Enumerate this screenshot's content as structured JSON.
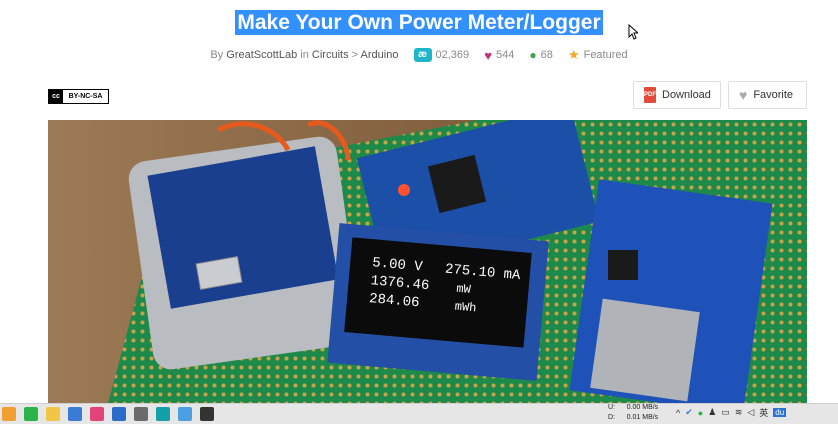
{
  "title": "Make Your Own Power Meter/Logger",
  "meta": {
    "by": "By",
    "author": "GreatScottLab",
    "in": "in",
    "category": "Circuits",
    "sep": ">",
    "subcategory": "Arduino",
    "views": "02,369",
    "favorites": "544",
    "comments": "68",
    "featured": "Featured"
  },
  "license": {
    "icon": "cc",
    "text": "BY-NC-SA"
  },
  "buttons": {
    "download": "Download",
    "favorite": "Favorite",
    "pdf_icon": "PDF"
  },
  "oled": {
    "line1a": "5.00  V",
    "line1b": "275.10 mA",
    "line2a": "1376.46",
    "line2b": "mW",
    "line3a": "284.06",
    "line3b": "mWh"
  },
  "taskbar": {
    "upload_label": "U:",
    "upload_rate": "0.00 MB/s",
    "download_label": "D:",
    "download_rate": "0.01 MB/s",
    "ime": "英",
    "baidu": "du"
  }
}
